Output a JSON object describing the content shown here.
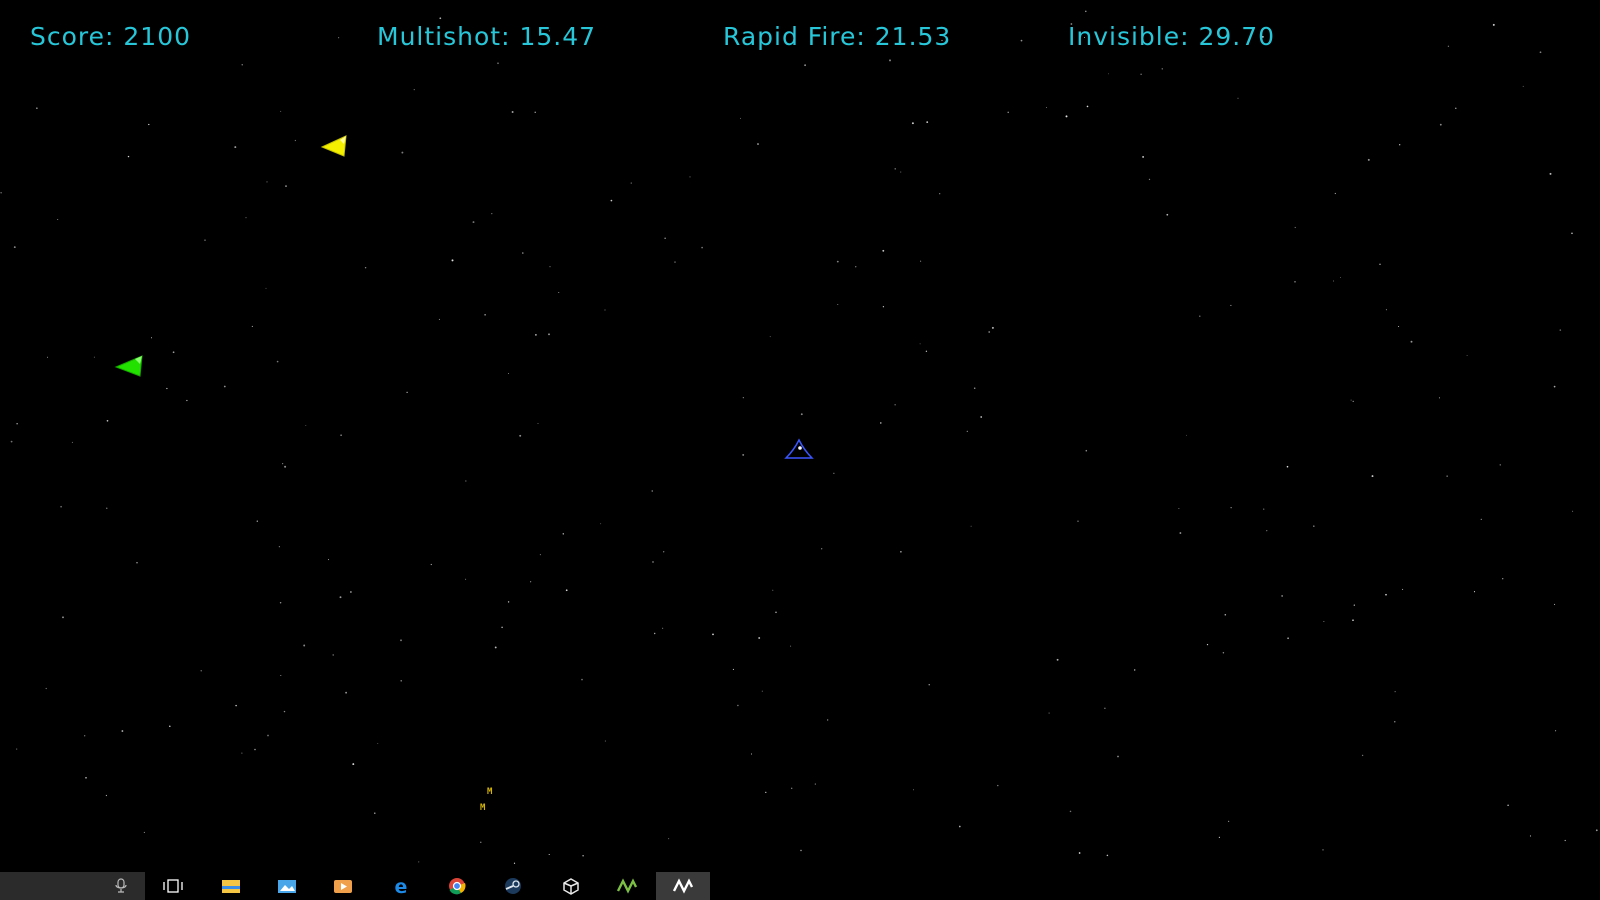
{
  "hud": {
    "score_label": "Score",
    "score_value": "2100",
    "multishot_label": "Multishot",
    "multishot_value": "15.47",
    "rapid_fire_label": "Rapid Fire",
    "rapid_fire_value": "21.53",
    "invisible_label": "Invisible",
    "invisible_value": "29.70"
  },
  "colors": {
    "hud_text": "#27c7d9",
    "background": "#000000",
    "enemy_yellow": "#f5f000",
    "enemy_green": "#22e000",
    "player_outline": "#3a56ff",
    "pickup": "#d4b400"
  },
  "pickups": [
    {
      "letter": "M"
    },
    {
      "letter": "M"
    }
  ],
  "taskbar": {
    "items": [
      {
        "name": "task-view-icon"
      },
      {
        "name": "file-explorer-icon"
      },
      {
        "name": "photos-icon"
      },
      {
        "name": "media-player-icon"
      },
      {
        "name": "edge-icon"
      },
      {
        "name": "chrome-icon"
      },
      {
        "name": "steam-icon"
      },
      {
        "name": "unity-icon"
      },
      {
        "name": "gamemaker-icon"
      },
      {
        "name": "gamemaker-active-icon"
      }
    ]
  }
}
